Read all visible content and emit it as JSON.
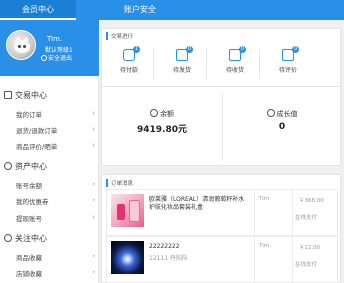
{
  "top_tabs": [
    {
      "label": "会员中心",
      "active": true
    },
    {
      "label": "账户安全",
      "active": false
    }
  ],
  "profile": {
    "username": "Tim.",
    "level": "默认等级1",
    "logout": "安全退出"
  },
  "sections": [
    {
      "title": "交易中心",
      "items": [
        "我的订单",
        "退货/退款订单",
        "商品评价/晒单"
      ]
    },
    {
      "title": "资产中心",
      "items": [
        "账号余额",
        "我的优惠券",
        "提现账号"
      ]
    },
    {
      "title": "关注中心",
      "items": [
        "商品收藏",
        "店铺收藏"
      ]
    }
  ],
  "progress": {
    "title": "交易进行",
    "steps": [
      {
        "label": "待付款",
        "count": "1",
        "icon": "wallet-icon"
      },
      {
        "label": "待发货",
        "count": "0",
        "icon": "package-icon"
      },
      {
        "label": "待收货",
        "count": "0",
        "icon": "truck-icon"
      },
      {
        "label": "待评价",
        "count": "0",
        "icon": "comment-icon"
      }
    ]
  },
  "stats": [
    {
      "label": "余额",
      "value": "9419.80元",
      "icon": "coin-icon"
    },
    {
      "label": "成长值",
      "value": "0",
      "icon": "growth-icon"
    }
  ],
  "orders": {
    "title": "订单消息",
    "items": [
      {
        "name": "欧莱雅（LOREAL）清润葡萄籽补水护肤化妆品套装礼盒",
        "sub": "",
        "buyer": "Tim.",
        "price": "￥368.00",
        "status": "在线支付"
      },
      {
        "name": "22222222",
        "sub": "12111 丹阳队",
        "buyer": "Tim.",
        "price": "￥22.00",
        "status": "在线支付"
      }
    ]
  },
  "colors": {
    "accent": "#2a8fe6"
  }
}
